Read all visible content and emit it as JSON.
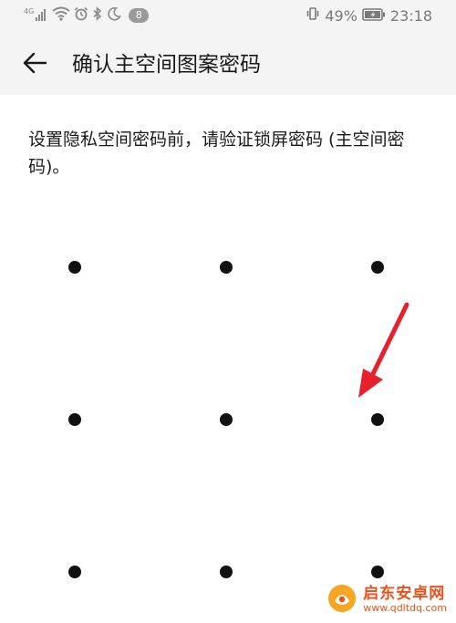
{
  "status_bar": {
    "network_label": "4G",
    "notification_count": "8",
    "battery_percent": "49%",
    "time": "23:18"
  },
  "header": {
    "title": "确认主空间图案密码"
  },
  "main": {
    "description": "设置隐私空间密码前，请验证锁屏密码 (主空间密码)。"
  },
  "pattern": {
    "dot_count": 9
  },
  "watermark": {
    "name": "启东安卓网",
    "url": "www.qdltdq.com"
  },
  "colors": {
    "status_bg": "#f4f4f4",
    "dot": "#111111",
    "arrow": "#e8202b",
    "watermark": "#e8531d"
  },
  "icons": {
    "back": "arrow-left-icon",
    "signal": "signal-icon",
    "wifi": "wifi-icon",
    "alarm": "alarm-icon",
    "bluetooth": "bluetooth-icon",
    "moon": "moon-icon",
    "vibrate": "vibrate-icon",
    "battery": "battery-icon"
  }
}
